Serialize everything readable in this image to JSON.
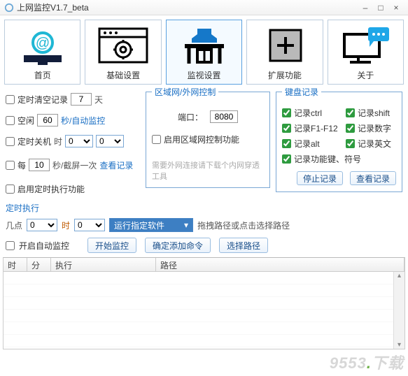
{
  "window": {
    "title": "上网监控V1.7_beta"
  },
  "toolbar": {
    "items": [
      {
        "label": "首页"
      },
      {
        "label": "基础设置"
      },
      {
        "label": "监视设置"
      },
      {
        "label": "扩展功能"
      },
      {
        "label": "关于"
      }
    ]
  },
  "left": {
    "clear_label": "定时清空记录",
    "clear_val": "7",
    "clear_unit": "天",
    "idle_label": "空闲",
    "idle_val": "60",
    "idle_unit": "秒/自动监控",
    "shutdown_label": "定时关机",
    "shutdown_h": "时",
    "shutdown_hv": "0",
    "shutdown_mv": "0",
    "every_label": "每",
    "every_val": "10",
    "every_unit": "秒/截屏一次",
    "view_log": "查看记录",
    "enable_timer": "启用定时执行功能"
  },
  "area": {
    "legend": "区域网/外网控制",
    "port_label": "端口：",
    "port_val": "8080",
    "enable_label": "启用区域网控制功能",
    "tip": "需要外网连接请下载个内网穿透工具"
  },
  "kb": {
    "legend": "键盘记录",
    "c1": "记录ctrl",
    "c2": "记录shift",
    "c3": "记录F1-F12",
    "c4": "记录数字",
    "c5": "记录alt",
    "c6": "记录英文",
    "c7": "记录功能键、符号",
    "stop": "停止记录",
    "view": "查看记录"
  },
  "sched": {
    "head": "定时执行",
    "at": "几点",
    "hv": "0",
    "hs": "时",
    "mv": "0",
    "action": "运行指定软件",
    "hint": "拖拽路径或点击选择路径",
    "auto": "开启自动监控",
    "start": "开始监控",
    "addcmd": "确定添加命令",
    "choose": "选择路径"
  },
  "table": {
    "c1": "时",
    "c2": "分",
    "c3": "执行",
    "c4": "路径"
  },
  "watermark": {
    "a": "9553",
    "b": "下载"
  }
}
